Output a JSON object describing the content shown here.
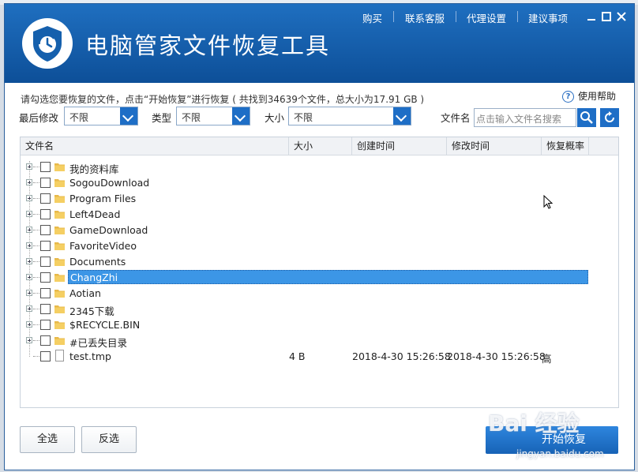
{
  "app": {
    "title": "电脑管家文件恢复工具",
    "menu": [
      "购买",
      "联系客服",
      "代理设置",
      "建议事项"
    ]
  },
  "description": "请勾选您要恢复的文件，点击“开始恢复”进行恢复 ( 共找到34639个文件，总大小为17.91 GB )",
  "help_label": "使用帮助",
  "filters": {
    "modified_label": "最后修改",
    "modified_value": "不限",
    "type_label": "类型",
    "type_value": "不限",
    "size_label": "大小",
    "size_value": "不限",
    "filename_label": "文件名",
    "filename_placeholder": "点击输入文件名搜索"
  },
  "table": {
    "columns": [
      "文件名",
      "大小",
      "创建时间",
      "修改时间",
      "恢复概率"
    ],
    "rows": [
      {
        "name": "我的资料库",
        "kind": "folder"
      },
      {
        "name": "SogouDownload",
        "kind": "folder"
      },
      {
        "name": "Program Files",
        "kind": "folder"
      },
      {
        "name": "Left4Dead",
        "kind": "folder"
      },
      {
        "name": "GameDownload",
        "kind": "folder"
      },
      {
        "name": "FavoriteVideo",
        "kind": "folder"
      },
      {
        "name": "Documents",
        "kind": "folder"
      },
      {
        "name": "ChangZhi",
        "kind": "folder",
        "selected": true
      },
      {
        "name": "Aotian",
        "kind": "folder"
      },
      {
        "name": "2345下载",
        "kind": "folder"
      },
      {
        "name": "$RECYCLE.BIN",
        "kind": "folder"
      },
      {
        "name": "#已丢失目录",
        "kind": "folder"
      },
      {
        "name": "test.tmp",
        "kind": "file",
        "size": "4 B",
        "created": "2018-4-30 15:26:58",
        "modified": "2018-4-30 15:26:58",
        "probability": "高"
      }
    ]
  },
  "buttons": {
    "select_all": "全选",
    "invert": "反选",
    "start": "开始恢复"
  },
  "watermark": {
    "logo": "Bai 经验",
    "url": "jingyan.baidu.com"
  },
  "colors": {
    "titlebar": "#1560ad",
    "accent": "#1e6ec6",
    "selection": "#3c96e6"
  }
}
